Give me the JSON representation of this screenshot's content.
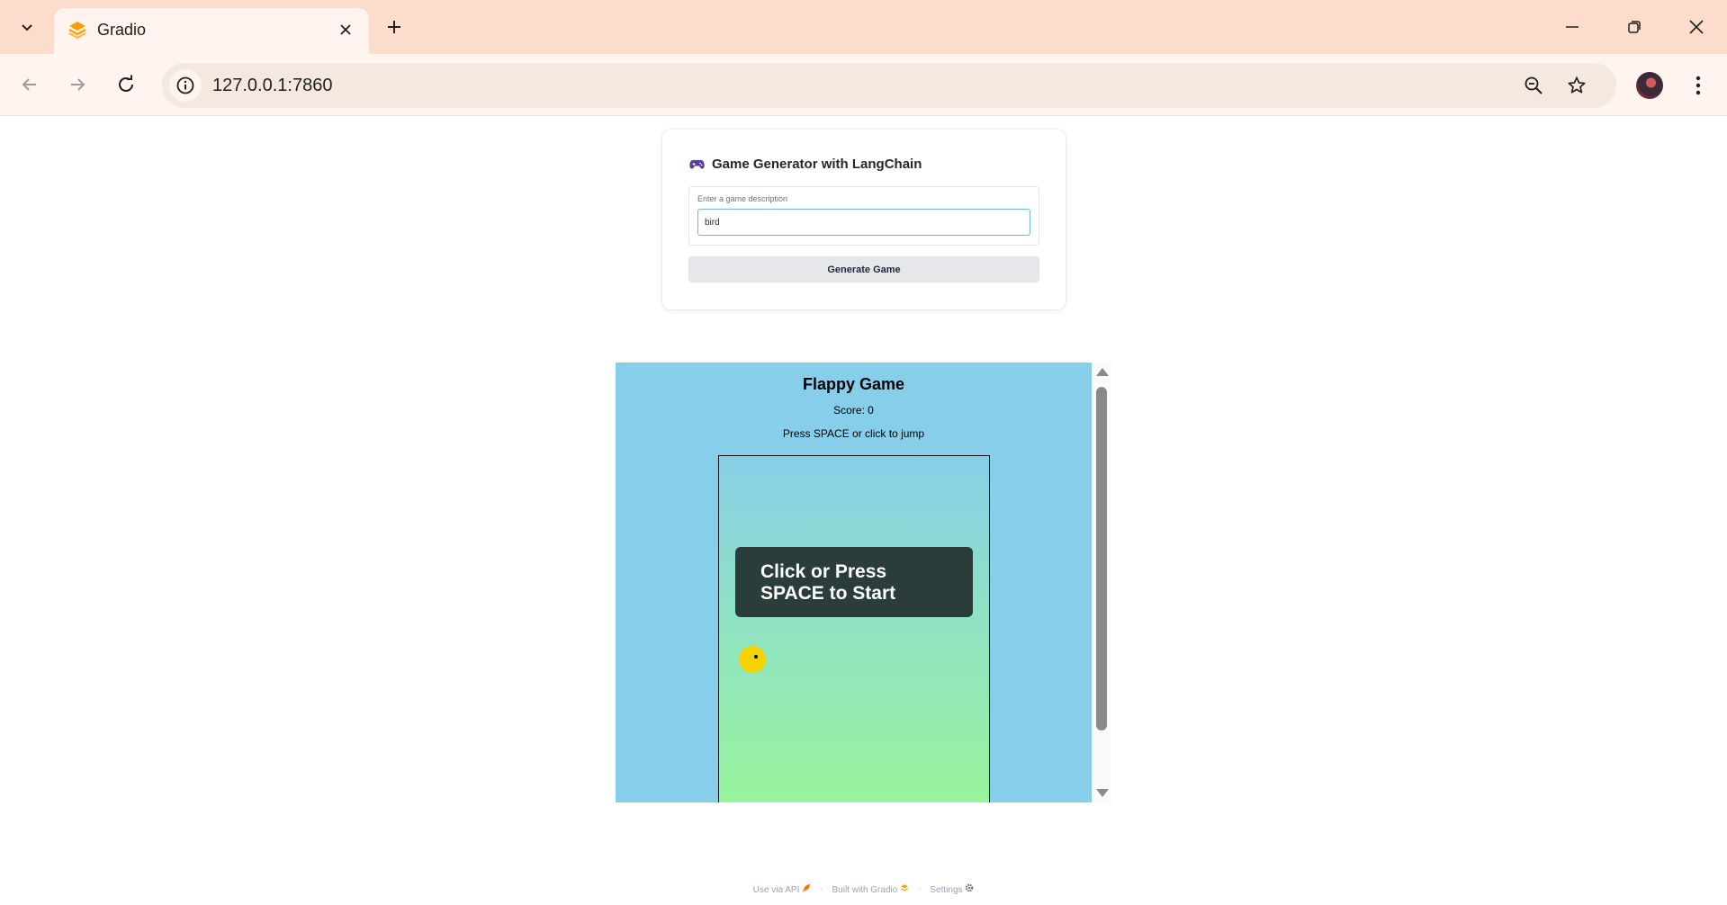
{
  "browser": {
    "tab_title": "Gradio",
    "url": "127.0.0.1:7860",
    "icons": {
      "tab_list": "chevron-down-icon",
      "favicon": "gradio-logo-icon",
      "tab_close": "close-icon",
      "new_tab": "plus-icon",
      "back": "arrow-left-icon",
      "forward": "arrow-right-icon",
      "reload": "reload-icon",
      "site_info": "info-icon",
      "zoom": "zoom-icon",
      "bookmark": "star-icon",
      "menu": "kebab-menu-icon"
    },
    "colors": {
      "tabbar": "#fcdccb",
      "toolbar": "#fff4ee"
    }
  },
  "app": {
    "heading": "Game Generator with LangChain",
    "heading_icon": "game-controller-icon",
    "input_label": "Enter a game description",
    "input_value": "bird",
    "generate_button": "Generate Game"
  },
  "game": {
    "title": "Flappy Game",
    "score": "Score: 0",
    "instructions": "Press SPACE or click to jump",
    "start_overlay": "Click or Press\nSPACE to Start",
    "colors": {
      "background": "#87ceea",
      "bird": "#f5d200",
      "overlay": "#2b3d3b",
      "sky_top": "#87cfe8",
      "ground_bottom": "#98f59a"
    }
  },
  "footer": {
    "use_api": "Use via API",
    "built_with": "Built with Gradio",
    "settings": "Settings"
  }
}
